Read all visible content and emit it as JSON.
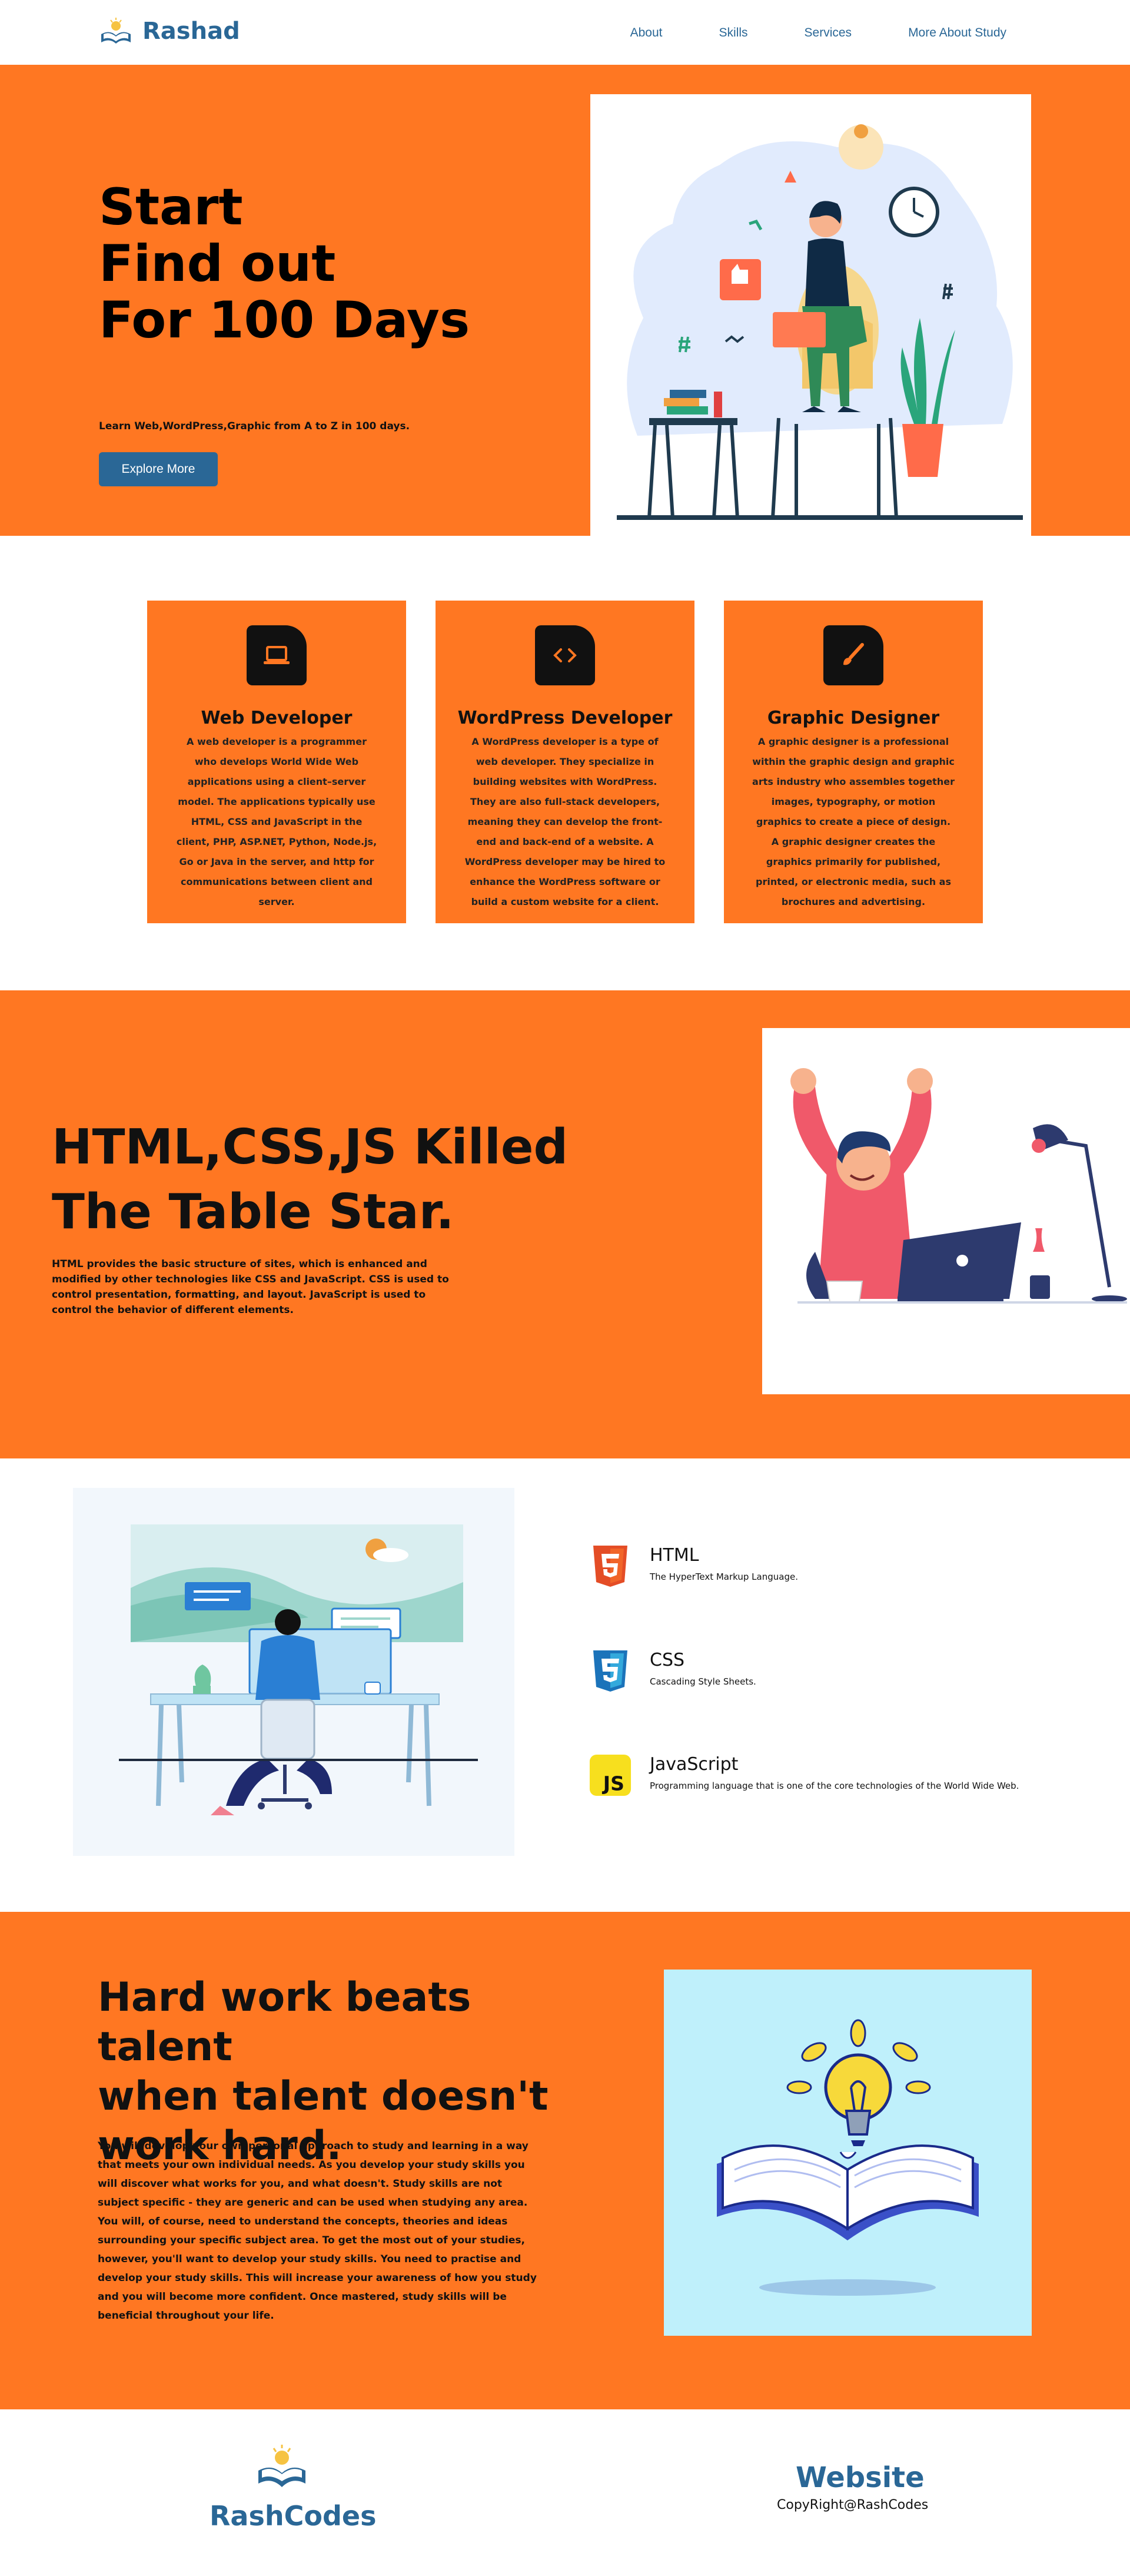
{
  "nav": {
    "brand": "Rashad",
    "links": [
      "About",
      "Skills",
      "Services",
      "More About Study"
    ]
  },
  "hero": {
    "title_lines": [
      "Start",
      "Find out",
      "For 100 Days"
    ],
    "subtitle": "Learn Web,WordPress,Graphic from A to Z in 100 days.",
    "button": "Explore More"
  },
  "services": [
    {
      "icon": "laptop-icon",
      "title": "Web Developer",
      "text": "A web developer is a programmer who develops World Wide Web applications using a client–server model. The applications typically use HTML, CSS and JavaScript in the client, PHP, ASP.NET, Python, Node.js, Go or Java in the server, and http for communications between client and server."
    },
    {
      "icon": "code-icon",
      "title": "WordPress Developer",
      "text": "A WordPress developer is a type of web developer. They specialize in building websites with WordPress. They are also full-stack developers, meaning they can develop the front-end and back-end of a website. A WordPress developer may be hired to enhance the WordPress software or build a custom website for a client."
    },
    {
      "icon": "brush-icon",
      "title": "Graphic Designer",
      "text": "A graphic designer is a professional within the graphic design and graphic arts industry who assembles together images, typography, or motion graphics to create a piece of design. A graphic designer creates the graphics primarily for published, printed, or electronic media, such as brochures and advertising."
    }
  ],
  "tablestar": {
    "title_lines": [
      "HTML,CSS,JS Killed",
      "The Table Star."
    ],
    "text": "HTML provides the basic structure of sites, which is enhanced and modified by other technologies like CSS and JavaScript. CSS is used to control presentation, formatting, and layout. JavaScript is used to control the behavior of different elements."
  },
  "tech": [
    {
      "name": "HTML",
      "desc": "The HyperText Markup Language.",
      "icon": "html5-icon",
      "color": "#e44d26"
    },
    {
      "name": "CSS",
      "desc": "Cascading Style Sheets.",
      "icon": "css3-icon",
      "color": "#1b73ba"
    },
    {
      "name": "JavaScript",
      "desc": "Programming language that is one of the core technologies of the World Wide Web.",
      "icon": "js-icon",
      "color": "#f7df1e"
    }
  ],
  "hard": {
    "title_lines": [
      "Hard work beats talent",
      "when talent doesn't",
      "work hard."
    ],
    "text": "You will develop your own personal approach to study and learning in a way that meets your own individual needs. As you develop your study skills you will discover what works for you, and what doesn't. Study skills are not subject specific - they are generic and can be used when studying any area. You will, of course, need to understand the concepts, theories and ideas surrounding your specific subject area. To get the most out of your studies, however, you'll want to develop your study skills. You need to practise and develop your study skills. This will increase your awareness of how you study and you will become more confident. Once mastered, study skills will be beneficial throughout your life."
  },
  "footer": {
    "brand": "RashCodes",
    "title": "Website",
    "copyright": "CopyRight@RashCodes"
  },
  "colors": {
    "orange": "#ff7722",
    "blue": "#2a6796"
  }
}
